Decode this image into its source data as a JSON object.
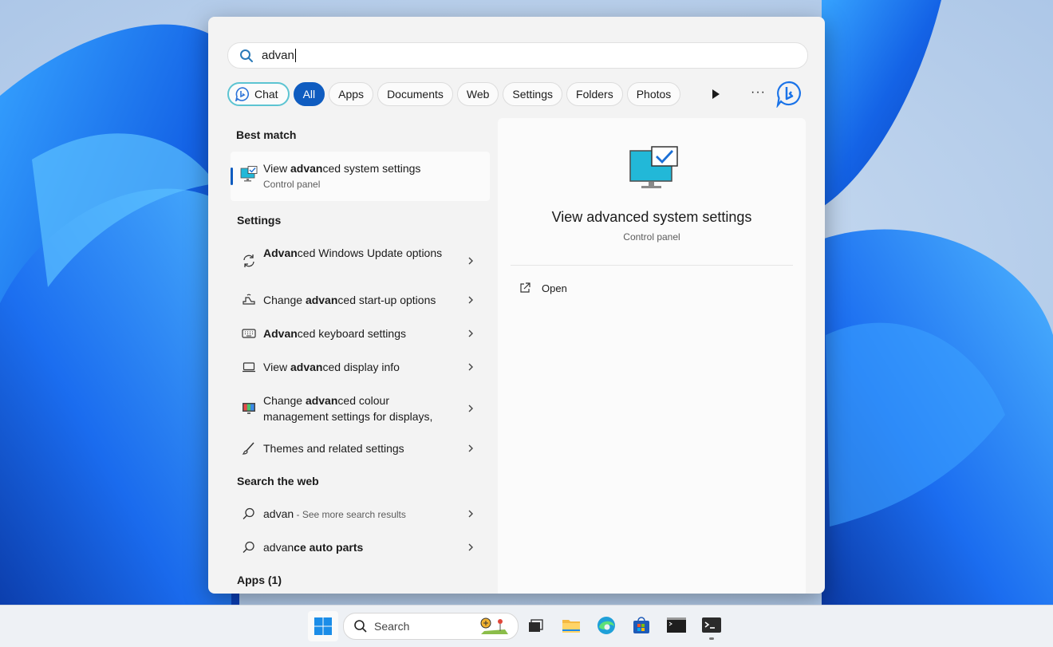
{
  "search": {
    "query": "advan"
  },
  "filters": [
    "Chat",
    "All",
    "Apps",
    "Documents",
    "Web",
    "Settings",
    "Folders",
    "Photos"
  ],
  "active_filter": "All",
  "best_match": {
    "heading": "Best match",
    "title_pre": "View ",
    "title_bold": "advan",
    "title_post": "ced system settings",
    "subtitle": "Control panel"
  },
  "settings": {
    "heading": "Settings",
    "items": [
      {
        "pre": "",
        "bold": "Advan",
        "post": "ced Windows Update options",
        "icon": "sync-icon"
      },
      {
        "pre": "Change ",
        "bold": "advan",
        "post": "ced start-up options",
        "icon": "startup-icon"
      },
      {
        "pre": "",
        "bold": "Advan",
        "post": "ced keyboard settings",
        "icon": "keyboard-icon"
      },
      {
        "pre": "View ",
        "bold": "advan",
        "post": "ced display info",
        "icon": "laptop-icon"
      },
      {
        "pre": "Change ",
        "bold": "advan",
        "post": "ced colour management settings for displays,",
        "icon": "color-display-icon"
      },
      {
        "pre": "Themes and related settings",
        "bold": "",
        "post": "",
        "icon": "brush-icon"
      }
    ]
  },
  "web": {
    "heading": "Search the web",
    "items": [
      {
        "bold": "advan",
        "rest": "",
        "note": " - See more search results"
      },
      {
        "bold": "advan",
        "rest": "ce auto parts",
        "note": ""
      }
    ]
  },
  "apps": {
    "heading": "Apps (1)"
  },
  "preview": {
    "title": "View advanced system settings",
    "subtitle": "Control panel",
    "action": "Open"
  },
  "taskbar": {
    "search_label": "Search"
  },
  "colors": {
    "accent": "#0f5cc0",
    "chat_border": "#5cc4d2"
  }
}
